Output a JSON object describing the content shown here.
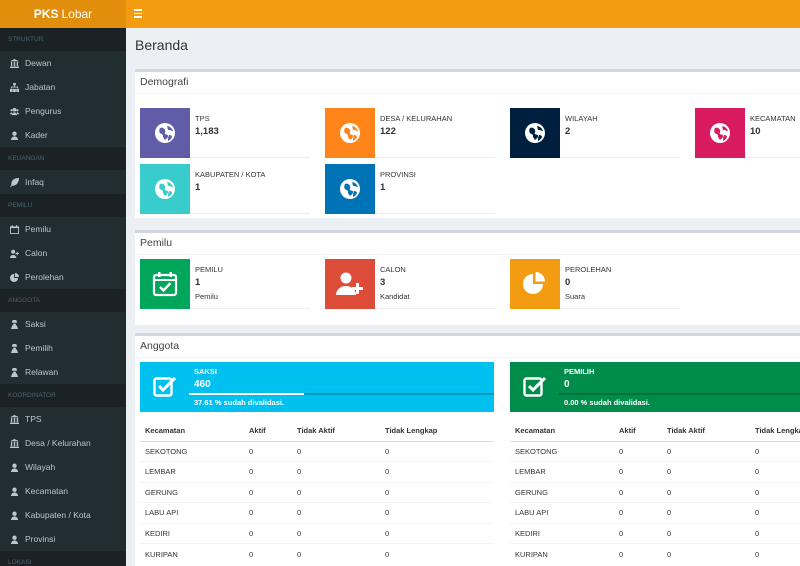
{
  "brand": {
    "bold": "PKS",
    "light": "Lobar"
  },
  "sidebar": {
    "sections": [
      {
        "header": "STRUKTUR",
        "items": [
          {
            "label": "Dewan",
            "icon": "bank-icon"
          },
          {
            "label": "Jabatan",
            "icon": "sitemap-icon"
          },
          {
            "label": "Pengurus",
            "icon": "users-icon"
          },
          {
            "label": "Kader",
            "icon": "user-icon"
          }
        ]
      },
      {
        "header": "KEUANGAN",
        "items": [
          {
            "label": "Infaq",
            "icon": "leaf-icon"
          }
        ]
      },
      {
        "header": "PEMILU",
        "items": [
          {
            "label": "Pemilu",
            "icon": "calendar-icon"
          },
          {
            "label": "Calon",
            "icon": "user-plus-icon"
          },
          {
            "label": "Perolehan",
            "icon": "pie-chart-icon"
          }
        ]
      },
      {
        "header": "ANGGOTA",
        "items": [
          {
            "label": "Saksi",
            "icon": "user-secret-icon"
          },
          {
            "label": "Pemilih",
            "icon": "user-secret-icon"
          },
          {
            "label": "Relawan",
            "icon": "user-secret-icon"
          }
        ]
      },
      {
        "header": "KOORDINATOR",
        "items": [
          {
            "label": "TPS",
            "icon": "bank-icon"
          },
          {
            "label": "Desa / Kelurahan",
            "icon": "bank-icon"
          },
          {
            "label": "Wilayah",
            "icon": "user-icon"
          },
          {
            "label": "Kecamatan",
            "icon": "user-icon"
          },
          {
            "label": "Kabupaten / Kota",
            "icon": "user-icon"
          },
          {
            "label": "Provinsi",
            "icon": "user-icon"
          }
        ]
      },
      {
        "header": "LOKASI",
        "items": []
      }
    ]
  },
  "page": {
    "title": "Beranda"
  },
  "demografi": {
    "title": "Demografi",
    "boxes": [
      {
        "label": "TPS",
        "value": "1,183",
        "color": "#605ca8"
      },
      {
        "label": "DESA / KELURAHAN",
        "value": "122",
        "color": "#ff851b"
      },
      {
        "label": "WILAYAH",
        "value": "2",
        "color": "#001f3f"
      },
      {
        "label": "KECAMATAN",
        "value": "10",
        "color": "#d81b60"
      },
      {
        "label": "KABUPATEN / KOTA",
        "value": "1",
        "color": "#39cccc"
      },
      {
        "label": "PROVINSI",
        "value": "1",
        "color": "#0073b7"
      }
    ]
  },
  "pemilu": {
    "title": "Pemilu",
    "boxes": [
      {
        "label": "PEMILU",
        "value": "1",
        "sub": "Pemilu",
        "color": "#00a65a",
        "icon": "calendar-check-icon"
      },
      {
        "label": "CALON",
        "value": "3",
        "sub": "Kandidat",
        "color": "#dd4b39",
        "icon": "user-plus-icon"
      },
      {
        "label": "PEROLEHAN",
        "value": "0",
        "sub": "Suara",
        "color": "#f39c12",
        "icon": "pie-chart-icon"
      }
    ]
  },
  "anggota": {
    "title": "Anggota",
    "panels": [
      {
        "label": "SAKSI",
        "value": "460",
        "progress": 0.3761,
        "desc": "37.61 % sudah divalidasi.",
        "color": "#00c0ef",
        "headers": [
          "Kecamatan",
          "Aktif",
          "Tidak Aktif",
          "Tidak Lengkap"
        ],
        "rows": [
          [
            "SEKOTONG",
            "0",
            "0",
            "0"
          ],
          [
            "LEMBAR",
            "0",
            "0",
            "0"
          ],
          [
            "GERUNG",
            "0",
            "0",
            "0"
          ],
          [
            "LABU API",
            "0",
            "0",
            "0"
          ],
          [
            "KEDIRI",
            "0",
            "0",
            "0"
          ],
          [
            "KURIPAN",
            "0",
            "0",
            "0"
          ]
        ]
      },
      {
        "label": "PEMILIH",
        "value": "0",
        "progress": 0.0,
        "desc": "0.00 % sudah divalidasi.",
        "color": "#008d4c",
        "headers": [
          "Kecamatan",
          "Aktif",
          "Tidak Aktif",
          "Tidak Lengkap"
        ],
        "rows": [
          [
            "SEKOTONG",
            "0",
            "0",
            "0"
          ],
          [
            "LEMBAR",
            "0",
            "0",
            "0"
          ],
          [
            "GERUNG",
            "0",
            "0",
            "0"
          ],
          [
            "LABU API",
            "0",
            "0",
            "0"
          ],
          [
            "KEDIRI",
            "0",
            "0",
            "0"
          ],
          [
            "KURIPAN",
            "0",
            "0",
            "0"
          ]
        ]
      }
    ]
  }
}
